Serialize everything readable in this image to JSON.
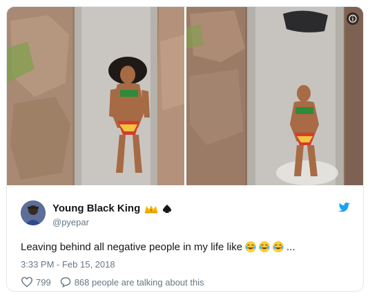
{
  "tweet": {
    "display_name": "Young Black King",
    "name_emojis": [
      "crown-icon",
      "spade-icon"
    ],
    "handle": "@pyepar",
    "text": "Leaving behind all negative people in my life like",
    "text_emojis": [
      "laughing-emoji",
      "laughing-emoji",
      "laughing-emoji"
    ],
    "text_suffix": "...",
    "timestamp": "3:33 PM - Feb 15, 2018",
    "likes": "799",
    "replies_text": "868 people are talking about this"
  },
  "colors": {
    "twitter_blue": "#1da1f2",
    "name_text": "#14171a",
    "secondary_text": "#657786",
    "border": "#e1e8ed"
  },
  "media": {
    "photos": [
      "water-slide-photo-1",
      "water-slide-photo-2"
    ],
    "info_icon": "info-icon"
  }
}
